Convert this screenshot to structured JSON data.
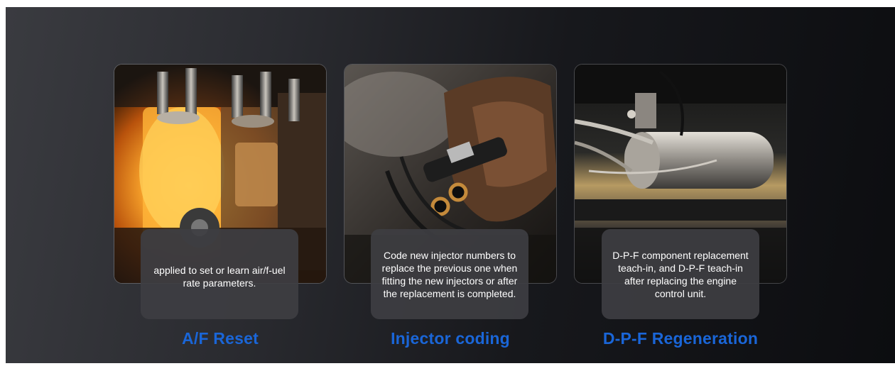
{
  "features": [
    {
      "title": "A/F Reset",
      "description": "applied to set or learn air/f-uel rate parameters."
    },
    {
      "title": "Injector coding",
      "description": "Code new injector numbers to replace the previous one when fitting the new injectors or after the replacement is completed."
    },
    {
      "title": "D-P-F Regeneration",
      "description": "D-P-F component replacement teach-in, and D-P-F teach-in after replacing the engine control unit."
    }
  ],
  "colors": {
    "title_accent": "#1a66d8",
    "caption_bg": "#3e3e42",
    "background": "#1a1b1f"
  }
}
